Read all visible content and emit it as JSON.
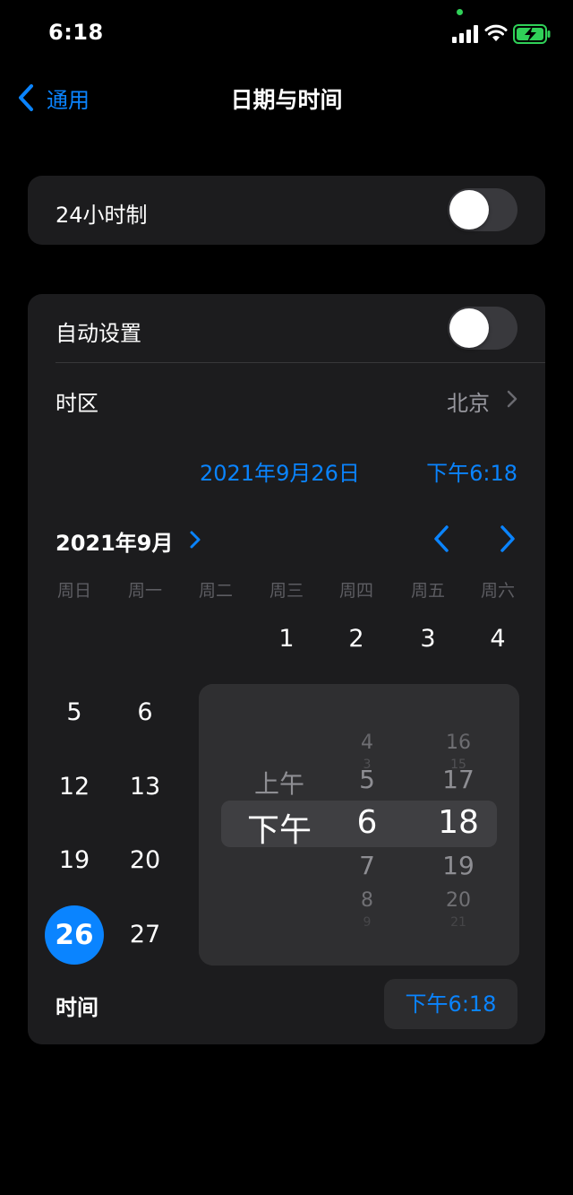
{
  "status": {
    "time": "6:18"
  },
  "nav": {
    "back_label": "通用",
    "title": "日期与时间"
  },
  "settings": {
    "hour24_label": "24小时制",
    "auto_label": "自动设置",
    "timezone_label": "时区",
    "timezone_value": "北京"
  },
  "selected": {
    "date": "2021年9月26日",
    "time": "下午6:18"
  },
  "calendar": {
    "month": "2021年9月",
    "weekdays": [
      "周日",
      "周一",
      "周二",
      "周三",
      "周四",
      "周五",
      "周六"
    ],
    "days": [
      {
        "label": "1",
        "col": 3,
        "row": 0
      },
      {
        "label": "2",
        "col": 4,
        "row": 0
      },
      {
        "label": "3",
        "col": 5,
        "row": 0
      },
      {
        "label": "4",
        "col": 6,
        "row": 0
      },
      {
        "label": "5",
        "col": 0,
        "row": 1
      },
      {
        "label": "6",
        "col": 1,
        "row": 1
      },
      {
        "label": "12",
        "col": 0,
        "row": 2
      },
      {
        "label": "13",
        "col": 1,
        "row": 2
      },
      {
        "label": "19",
        "col": 0,
        "row": 3
      },
      {
        "label": "20",
        "col": 1,
        "row": 3
      },
      {
        "label": "26",
        "col": 0,
        "row": 4,
        "selected": true
      },
      {
        "label": "27",
        "col": 1,
        "row": 4
      }
    ]
  },
  "picker": {
    "ampm": [
      {
        "label": "上午",
        "offset": -1
      },
      {
        "label": "下午",
        "offset": 0
      }
    ],
    "hours": [
      {
        "label": "3",
        "offset": -3
      },
      {
        "label": "4",
        "offset": -2
      },
      {
        "label": "5",
        "offset": -1
      },
      {
        "label": "6",
        "offset": 0
      },
      {
        "label": "7",
        "offset": 1
      },
      {
        "label": "8",
        "offset": 2
      },
      {
        "label": "9",
        "offset": 3
      }
    ],
    "minutes": [
      {
        "label": "15",
        "offset": -3
      },
      {
        "label": "16",
        "offset": -2
      },
      {
        "label": "17",
        "offset": -1
      },
      {
        "label": "18",
        "offset": 0
      },
      {
        "label": "19",
        "offset": 1
      },
      {
        "label": "20",
        "offset": 2
      },
      {
        "label": "21",
        "offset": 3
      }
    ]
  },
  "time_row": {
    "label": "时间",
    "value": "下午6:18"
  },
  "colors": {
    "accent": "#0a84ff",
    "card": "#1c1c1e",
    "toggle_off": "#39393d",
    "battery": "#30d158"
  }
}
